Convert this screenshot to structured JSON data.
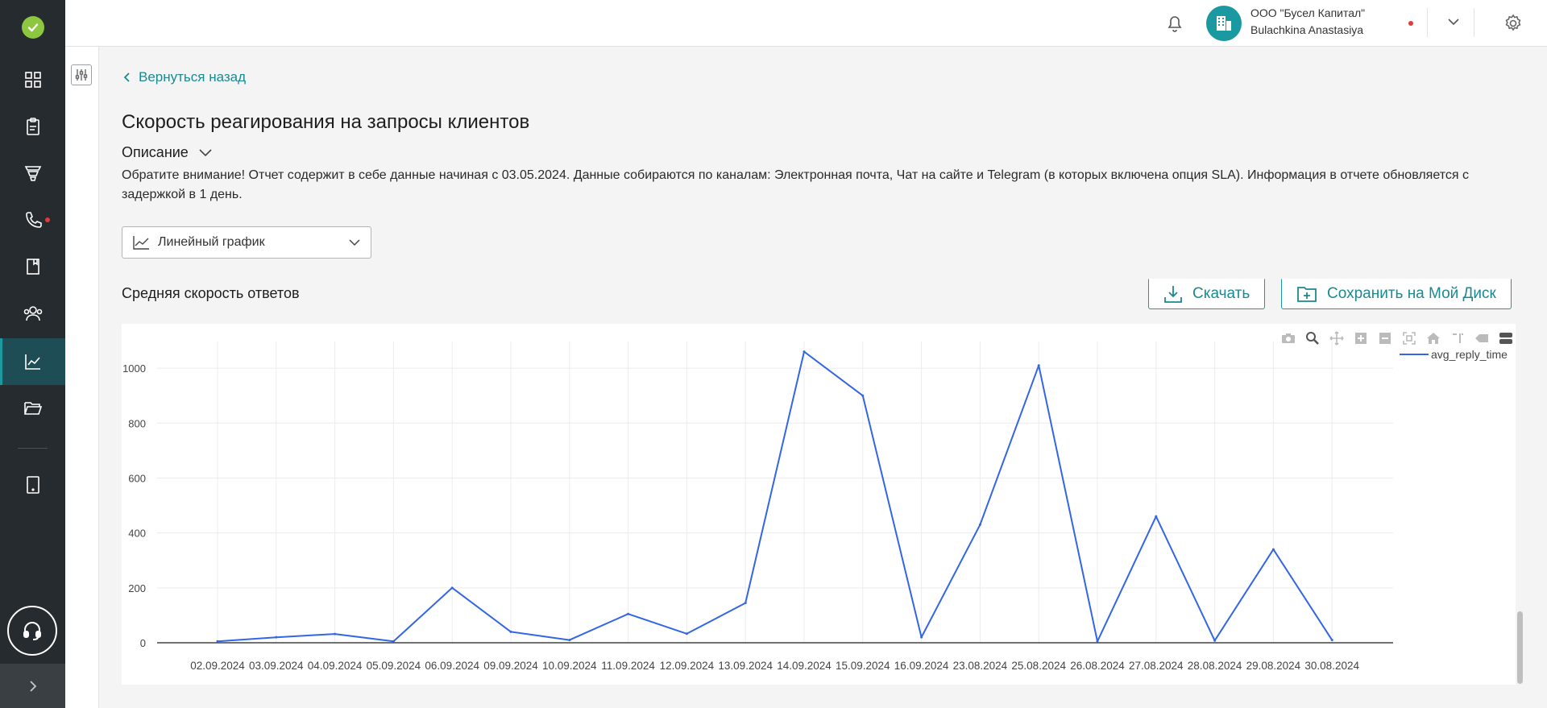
{
  "sidebar": {
    "items": [
      {
        "name": "dashboard",
        "icon": "grid-icon"
      },
      {
        "name": "documents",
        "icon": "clipboard-icon"
      },
      {
        "name": "funnel",
        "icon": "funnel-icon"
      },
      {
        "name": "calls",
        "icon": "phone-icon",
        "badge": true
      },
      {
        "name": "book",
        "icon": "book-icon"
      },
      {
        "name": "contacts",
        "icon": "users-icon"
      },
      {
        "name": "analytics",
        "icon": "chart-line-icon",
        "active": true
      },
      {
        "name": "files",
        "icon": "folder-icon"
      },
      {
        "name": "device",
        "icon": "tablet-icon"
      }
    ],
    "accent": "#1a9aa0"
  },
  "header": {
    "company_name": "ООО \"Бусел Капитал\"",
    "user_name": "Bulachkina Anastasiya"
  },
  "page": {
    "back_label": "Вернуться назад",
    "title": "Скорость реагирования на запросы клиентов",
    "description_label": "Описание",
    "description_text": "Обратите внимание! Отчет содержит в себе данные начиная с 03.05.2024. Данные собираются по каналам: Электронная почта, Чат на сайте и Telegram (в которых включена опция SLA). Информация в отчете обновляется с задержкой в 1 день.",
    "chart_type_selected": "Линейный график",
    "section_title": "Средняя скорость ответов",
    "download_label": "Скачать",
    "save_label": "Сохранить на Мой Диск"
  },
  "chart_data": {
    "type": "line",
    "x": [
      "02.09.2024",
      "03.09.2024",
      "04.09.2024",
      "05.09.2024",
      "06.09.2024",
      "09.09.2024",
      "10.09.2024",
      "11.09.2024",
      "12.09.2024",
      "13.09.2024",
      "14.09.2024",
      "15.09.2024",
      "16.09.2024",
      "23.08.2024",
      "25.08.2024",
      "26.08.2024",
      "27.08.2024",
      "28.08.2024",
      "29.08.2024",
      "30.08.2024"
    ],
    "series": [
      {
        "name": "avg_reply_time",
        "color": "#3366e6",
        "values": [
          5,
          20,
          32,
          5,
          200,
          40,
          10,
          105,
          33,
          145,
          1060,
          900,
          20,
          430,
          1010,
          5,
          460,
          8,
          340,
          10
        ]
      }
    ],
    "yticks": [
      0,
      200,
      400,
      600,
      800,
      1000
    ],
    "ylim": [
      -40,
      1120
    ],
    "grid": true,
    "legend": "top-right"
  }
}
